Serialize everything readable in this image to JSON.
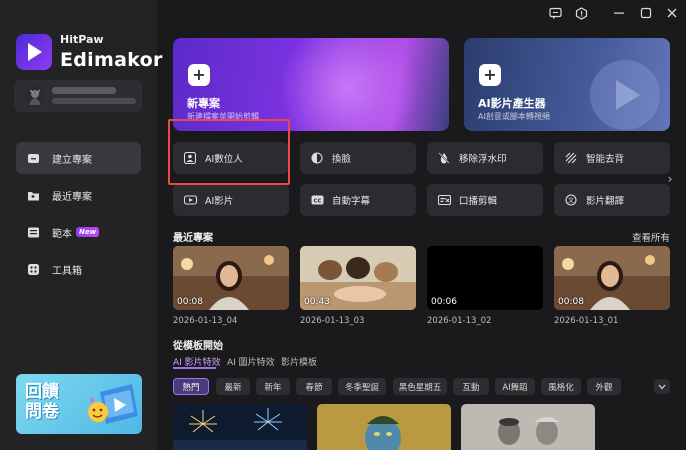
{
  "brand": {
    "line1": "HitPaw",
    "line2": "Edimakor"
  },
  "sidebar": {
    "items": [
      {
        "label": "建立專案",
        "icon": "new-project-icon",
        "active": true
      },
      {
        "label": "最近專案",
        "icon": "recent-folder-icon",
        "active": false
      },
      {
        "label": "範本",
        "icon": "template-icon",
        "active": false,
        "badge": "New"
      },
      {
        "label": "工具箱",
        "icon": "toolbox-icon",
        "active": false
      }
    ],
    "promo": {
      "text": "回饋問卷"
    }
  },
  "hero": [
    {
      "title": "新專案",
      "subtitle": "新建檔案並開始剪輯"
    },
    {
      "title": "AI影片產生器",
      "subtitle": "AI創意或腳本轉視頻"
    }
  ],
  "tools": [
    {
      "label": "AI數位人",
      "icon": "digital-human-icon"
    },
    {
      "label": "換臉",
      "icon": "face-swap-icon"
    },
    {
      "label": "移除浮水印",
      "icon": "remove-watermark-icon"
    },
    {
      "label": "智能去背",
      "icon": "background-removal-icon"
    },
    {
      "label": "AI影片",
      "icon": "ai-video-icon"
    },
    {
      "label": "自動字幕",
      "icon": "auto-subtitle-icon"
    },
    {
      "label": "口播剪輯",
      "icon": "voice-edit-icon"
    },
    {
      "label": "影片翻譯",
      "icon": "video-translate-icon"
    }
  ],
  "recent": {
    "title": "最近專案",
    "see_all": "查看所有",
    "items": [
      {
        "name": "2026-01-13_04",
        "duration": "00:08"
      },
      {
        "name": "2026-01-13_03",
        "duration": "00:43"
      },
      {
        "name": "2026-01-13_02",
        "duration": "00:06"
      },
      {
        "name": "2026-01-13_01",
        "duration": "00:08"
      }
    ]
  },
  "templates": {
    "title": "從模板開始",
    "tabs": [
      "AI 影片特效",
      "AI 圖片特效",
      "影片模板"
    ],
    "chips": [
      "熱門",
      "最新",
      "新年",
      "春節",
      "冬季聖誕",
      "黑色星期五",
      "互動",
      "AI舞蹈",
      "風格化",
      "外觀"
    ]
  },
  "colors": {
    "accent": "#a56cf5",
    "highlight": "#e84a4a"
  }
}
